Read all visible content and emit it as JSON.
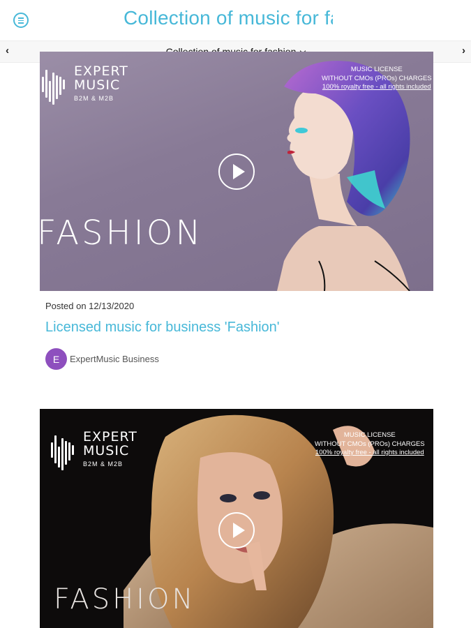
{
  "header": {
    "title": "Collection of music for fa",
    "menu_icon": "menu-icon",
    "accent_color": "#47b8d8"
  },
  "subheader": {
    "collection_label": "Collection of music for fashion",
    "prev_glyph": "‹",
    "next_glyph": "›"
  },
  "posts": [
    {
      "logo": {
        "name_line1": "EXPERT",
        "name_line2": "MUSIC",
        "sub": "B2M & M2B"
      },
      "license": {
        "line1": "MUSIC LICENSE",
        "line2": "WITHOUT CMOs (PROs) CHARGES",
        "line3": "100% royalty free - all rights included"
      },
      "overlay_text": "FASHION",
      "date": "Posted on 12/13/2020",
      "title": "Licensed music for business 'Fashion'",
      "author_initial": "E",
      "author": "ExpertMusic Business",
      "avatar_color": "#8e4fbe"
    },
    {
      "logo": {
        "name_line1": "EXPERT",
        "name_line2": "MUSIC",
        "sub": "B2M & M2B"
      },
      "license": {
        "line1": "MUSIC LICENSE",
        "line2": "WITHOUT CMOs (PROs) CHARGES",
        "line3": "100% royalty free - all rights included"
      },
      "overlay_text": "FASHION"
    }
  ]
}
